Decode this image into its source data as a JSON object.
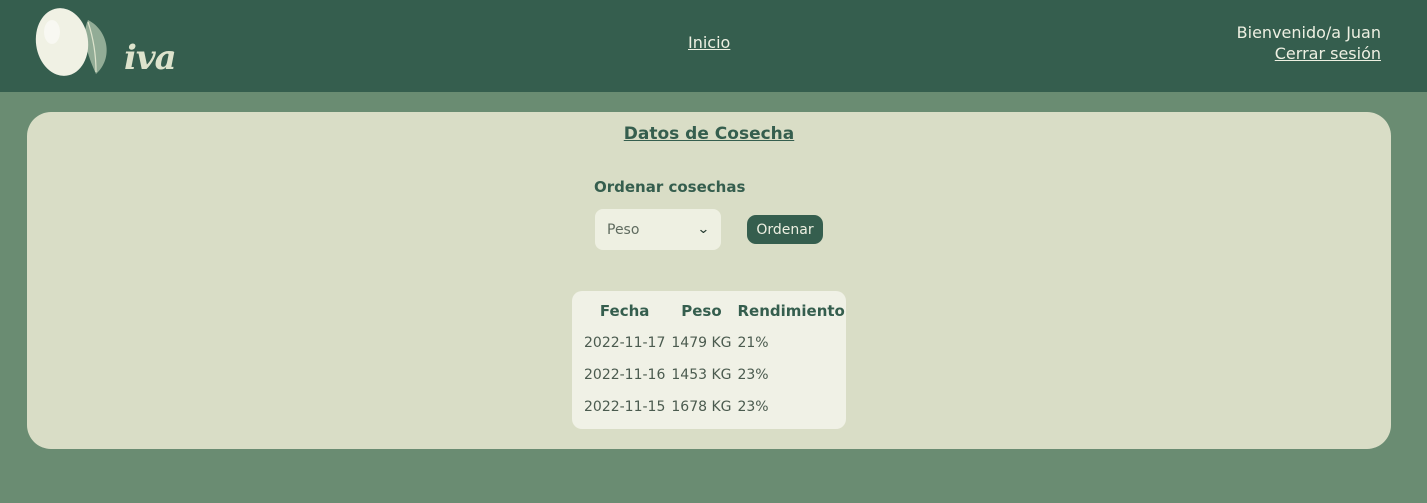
{
  "header": {
    "logo_text": "iva",
    "nav_home": "Inicio",
    "welcome": "Bienvenido/a Juan",
    "logout": "Cerrar sesión"
  },
  "panel": {
    "title": "Datos de Cosecha",
    "sort_label": "Ordenar cosechas",
    "sort_selected": "Peso",
    "sort_button": "Ordenar"
  },
  "table": {
    "headers": [
      "Fecha",
      "Peso",
      "Rendimiento"
    ],
    "rows": [
      [
        "2022-11-17",
        "1479 KG",
        "21%"
      ],
      [
        "2022-11-16",
        "1453 KG",
        "23%"
      ],
      [
        "2022-11-15",
        "1678 KG",
        "23%"
      ]
    ]
  },
  "colors": {
    "header_bg": "#355e4e",
    "page_bg": "#6a8c72",
    "panel_bg": "#d9ddc6",
    "table_bg": "#f0f1e6"
  }
}
